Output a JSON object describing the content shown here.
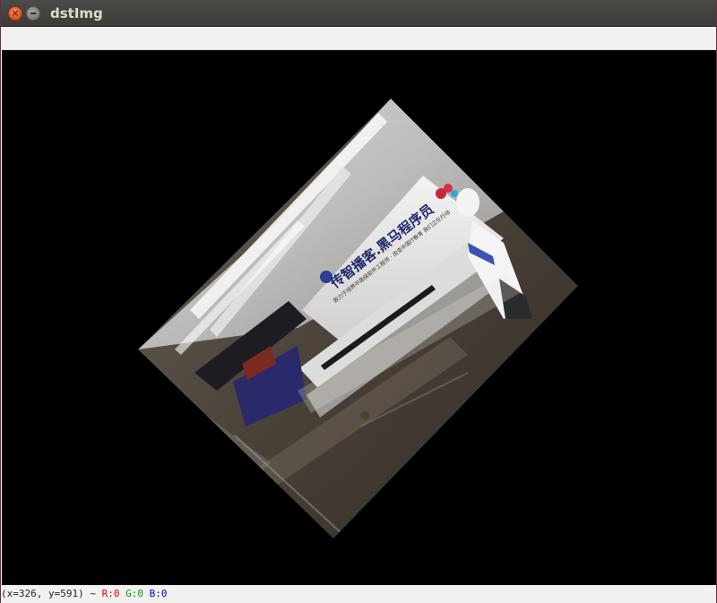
{
  "window": {
    "title": "dstImg"
  },
  "titlebar_buttons": {
    "close_glyph": "×"
  },
  "image": {
    "description_icon": "rotated-image",
    "sign_text_main": "传智播客.黑马程序员",
    "sign_text_sub": "致力于培养中高级软件工程师 · 改变中国IT教育 我们正在行动"
  },
  "status": {
    "coords": "(x=326, y=591)",
    "sep": " ~ ",
    "r_label": "R:0",
    "g_label": "G:0",
    "b_label": "B:0"
  },
  "colors": {
    "background": "#000000",
    "titlebar": "#3c3b37",
    "close_button": "#e0511b"
  }
}
